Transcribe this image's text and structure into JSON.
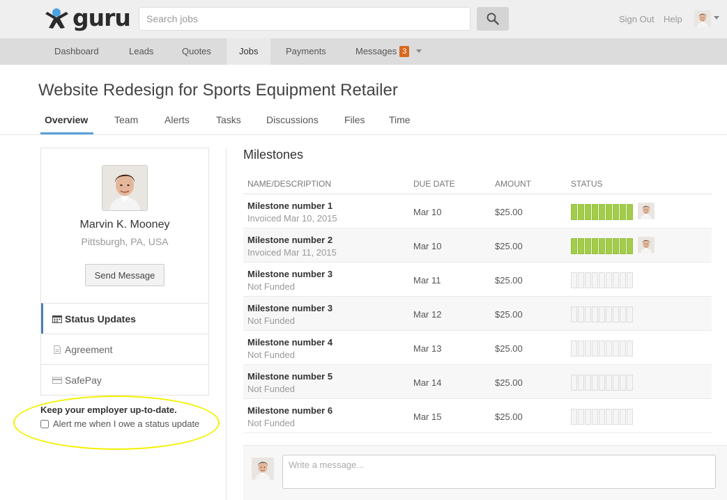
{
  "brand": {
    "name": "guru"
  },
  "search": {
    "placeholder": "Search jobs"
  },
  "header": {
    "sign_out": "Sign Out",
    "help": "Help"
  },
  "nav": {
    "items": [
      "Dashboard",
      "Leads",
      "Quotes",
      "Jobs",
      "Payments",
      "Messages"
    ],
    "active": "Jobs",
    "messages_badge": "3"
  },
  "page": {
    "title": "Website Redesign for Sports Equipment Retailer"
  },
  "tabs": [
    "Overview",
    "Team",
    "Alerts",
    "Tasks",
    "Discussions",
    "Files",
    "Time"
  ],
  "profile": {
    "name": "Marvin K. Mooney",
    "location": "Pittsburgh, PA, USA",
    "send_message": "Send Message"
  },
  "sidebar": {
    "items": [
      {
        "label": "Status Updates",
        "icon": "calendar-icon"
      },
      {
        "label": "Agreement",
        "icon": "document-icon"
      },
      {
        "label": "SafePay",
        "icon": "credit-card-icon"
      }
    ]
  },
  "status_update": {
    "heading": "Keep your employer up-to-date.",
    "checkbox_label": "Alert me when I owe a status update"
  },
  "milestones": {
    "title": "Milestones",
    "columns": [
      "NAME/DESCRIPTION",
      "DUE DATE",
      "AMOUNT",
      "STATUS"
    ],
    "rows": [
      {
        "name": "Milestone number 1",
        "status_text": "Invoiced Mar 10, 2015",
        "due": "Mar 10",
        "amount": "$25.00",
        "progress": 1.0
      },
      {
        "name": "Milestone number 2",
        "status_text": "Invoiced Mar 11, 2015",
        "due": "Mar 10",
        "amount": "$25.00",
        "progress": 1.0
      },
      {
        "name": "Milestone number 3",
        "status_text": "Not Funded",
        "due": "Mar 11",
        "amount": "$25.00",
        "progress": 0
      },
      {
        "name": "Milestone number 3",
        "status_text": "Not Funded",
        "due": "Mar 12",
        "amount": "$25.00",
        "progress": 0
      },
      {
        "name": "Milestone number 4",
        "status_text": "Not Funded",
        "due": "Mar 13",
        "amount": "$25.00",
        "progress": 0
      },
      {
        "name": "Milestone number 5",
        "status_text": "Not Funded",
        "due": "Mar 14",
        "amount": "$25.00",
        "progress": 0
      },
      {
        "name": "Milestone number 6",
        "status_text": "Not Funded",
        "due": "Mar 15",
        "amount": "$25.00",
        "progress": 0
      }
    ]
  },
  "composer": {
    "placeholder": "Write a message..."
  },
  "colors": {
    "accent": "#5aa0d8",
    "progress_on": "#a3cc4a",
    "badge": "#d9681f",
    "highlight": "#f4f000"
  }
}
